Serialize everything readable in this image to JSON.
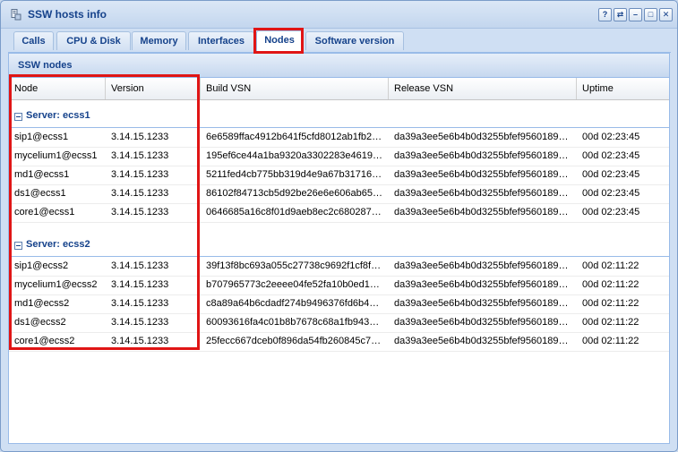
{
  "window": {
    "title": "SSW hosts info"
  },
  "tool_buttons": [
    "?",
    "⇄",
    "–",
    "□",
    "✕"
  ],
  "tabs": [
    {
      "label": "Calls"
    },
    {
      "label": "CPU & Disk"
    },
    {
      "label": "Memory"
    },
    {
      "label": "Interfaces"
    },
    {
      "label": "Nodes"
    },
    {
      "label": "Software version"
    }
  ],
  "active_tab": "Nodes",
  "panel": {
    "title": "SSW nodes"
  },
  "columns": [
    "Node",
    "Version",
    "Build VSN",
    "Release VSN",
    "Uptime"
  ],
  "groups": [
    {
      "label": "Server: ecss1",
      "rows": [
        [
          "sip1@ecss1",
          "3.14.15.1233",
          "6e6589ffac4912b641f5cfd8012ab1fb2…",
          "da39a3ee5e6b4b0d3255bfef9560189…",
          "00d 02:23:45"
        ],
        [
          "mycelium1@ecss1",
          "3.14.15.1233",
          "195ef6ce44a1ba9320a3302283e4619…",
          "da39a3ee5e6b4b0d3255bfef9560189…",
          "00d 02:23:45"
        ],
        [
          "md1@ecss1",
          "3.14.15.1233",
          "5211fed4cb775bb319d4e9a67b31716…",
          "da39a3ee5e6b4b0d3255bfef9560189…",
          "00d 02:23:45"
        ],
        [
          "ds1@ecss1",
          "3.14.15.1233",
          "86102f84713cb5d92be26e6e606ab65…",
          "da39a3ee5e6b4b0d3255bfef9560189…",
          "00d 02:23:45"
        ],
        [
          "core1@ecss1",
          "3.14.15.1233",
          "0646685a16c8f01d9aeb8ec2c680287…",
          "da39a3ee5e6b4b0d3255bfef9560189…",
          "00d 02:23:45"
        ]
      ]
    },
    {
      "label": "Server: ecss2",
      "rows": [
        [
          "sip1@ecss2",
          "3.14.15.1233",
          "39f13f8bc693a055c27738c9692f1cf8f…",
          "da39a3ee5e6b4b0d3255bfef9560189…",
          "00d 02:11:22"
        ],
        [
          "mycelium1@ecss2",
          "3.14.15.1233",
          "b707965773c2eeee04fe52fa10b0ed1…",
          "da39a3ee5e6b4b0d3255bfef9560189…",
          "00d 02:11:22"
        ],
        [
          "md1@ecss2",
          "3.14.15.1233",
          "c8a89a64b6cdadf274b9496376fd6b4…",
          "da39a3ee5e6b4b0d3255bfef9560189…",
          "00d 02:11:22"
        ],
        [
          "ds1@ecss2",
          "3.14.15.1233",
          "60093616fa4c01b8b7678c68a1fb943…",
          "da39a3ee5e6b4b0d3255bfef9560189…",
          "00d 02:11:22"
        ],
        [
          "core1@ecss2",
          "3.14.15.1233",
          "25fecc667dceb0f896da54fb260845c7…",
          "da39a3ee5e6b4b0d3255bfef9560189…",
          "00d 02:11:22"
        ]
      ]
    }
  ],
  "colors": {
    "highlight": "#e01515",
    "accent_text": "#15428b",
    "border": "#99bbe8"
  }
}
